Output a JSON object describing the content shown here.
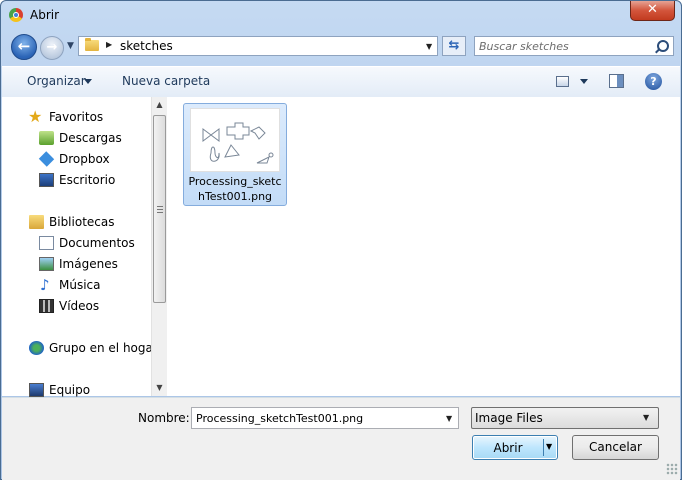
{
  "window": {
    "title": "Abrir",
    "close_label": "✕"
  },
  "nav": {
    "back_icon": "arrow-left-icon",
    "forward_icon": "arrow-right-icon",
    "breadcrumb": [
      "sketches"
    ],
    "search_placeholder": "Buscar sketches"
  },
  "toolbar": {
    "organize_label": "Organizar",
    "new_folder_label": "Nueva carpeta"
  },
  "sidebar": {
    "items": [
      {
        "label": "Favoritos",
        "icon": "star-icon"
      },
      {
        "label": "Descargas",
        "icon": "downloads-icon"
      },
      {
        "label": "Dropbox",
        "icon": "dropbox-icon"
      },
      {
        "label": "Escritorio",
        "icon": "desktop-icon"
      },
      {
        "label": "Bibliotecas",
        "icon": "libraries-icon"
      },
      {
        "label": "Documentos",
        "icon": "documents-icon"
      },
      {
        "label": "Imágenes",
        "icon": "pictures-icon"
      },
      {
        "label": "Música",
        "icon": "music-icon"
      },
      {
        "label": "Vídeos",
        "icon": "videos-icon"
      },
      {
        "label": "Grupo en el hogar",
        "icon": "homegroup-icon"
      },
      {
        "label": "Equipo",
        "icon": "computer-icon"
      }
    ]
  },
  "files": [
    {
      "name": "Processing_sketchTest001.png",
      "selected": true
    }
  ],
  "footer": {
    "name_label": "Nombre:",
    "name_value": "Processing_sketchTest001.png",
    "file_type": "Image Files",
    "open_label": "Abrir",
    "cancel_label": "Cancelar"
  },
  "colors": {
    "accent": "#2b64b6",
    "selection": "#cce4fb",
    "chrome": "#b3cbe9"
  }
}
